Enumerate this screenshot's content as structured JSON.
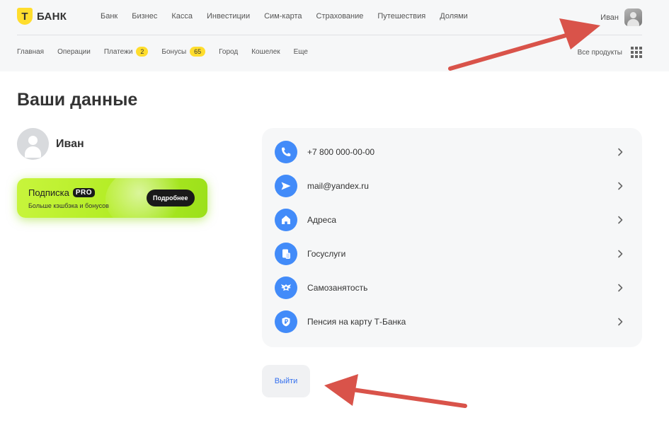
{
  "brand": {
    "logo_letter": "Т",
    "name": "БАНК"
  },
  "top_nav": [
    "Банк",
    "Бизнес",
    "Касса",
    "Инвестиции",
    "Сим-карта",
    "Страхование",
    "Путешествия",
    "Долями"
  ],
  "user": {
    "name": "Иван"
  },
  "sub_nav": [
    {
      "label": "Главная",
      "badge": null
    },
    {
      "label": "Операции",
      "badge": null
    },
    {
      "label": "Платежи",
      "badge": "2"
    },
    {
      "label": "Бонусы",
      "badge": "65"
    },
    {
      "label": "Город",
      "badge": null
    },
    {
      "label": "Кошелек",
      "badge": null
    },
    {
      "label": "Еще",
      "badge": null
    }
  ],
  "all_products": {
    "label": "Все продукты",
    "icon": "grid-icon"
  },
  "page": {
    "title": "Ваши данные"
  },
  "profile": {
    "name": "Иван"
  },
  "pro_card": {
    "title": "Подписка",
    "tag": "PRO",
    "subtitle": "Больше кэшбэка и бонусов",
    "button": "Подробнее"
  },
  "items": [
    {
      "label": "+7 800 000-00-00",
      "icon": "phone-icon"
    },
    {
      "label": "mail@yandex.ru",
      "icon": "mail-icon"
    },
    {
      "label": "Адреса",
      "icon": "home-icon"
    },
    {
      "label": "Госуслуги",
      "icon": "gosuslugi-icon"
    },
    {
      "label": "Самозанятость",
      "icon": "emblem-icon"
    },
    {
      "label": "Пенсия на карту Т-Банка",
      "icon": "ruble-icon"
    }
  ],
  "logout_label": "Выйти",
  "colors": {
    "accent_yellow": "#ffdd2d",
    "icon_blue": "#428bf9",
    "link_blue": "#336fee",
    "annotation_red": "#d9534a",
    "pro_green": "#b2ec24"
  }
}
